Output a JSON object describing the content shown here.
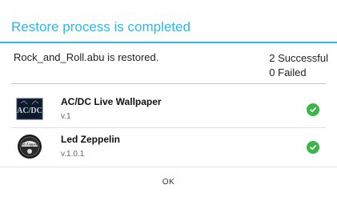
{
  "dialog": {
    "title": "Restore process is completed",
    "summary": {
      "message": "Rock_and_Roll.abu is restored.",
      "successful": "2 Successful",
      "failed": "0 Failed"
    },
    "items": [
      {
        "name": "AC/DC Live Wallpaper",
        "version": "v.1",
        "icon": "acdc-app-icon",
        "status": "success-check-icon",
        "icon_text": "AC/DC"
      },
      {
        "name": "Led Zeppelin",
        "version": "v.1.0.1",
        "icon": "led-zeppelin-app-icon",
        "status": "success-check-icon",
        "icon_text": "Led Zeppelin"
      }
    ],
    "ok_label": "OK"
  },
  "colors": {
    "title": "#33b5e5",
    "success": "#3bb54a"
  }
}
